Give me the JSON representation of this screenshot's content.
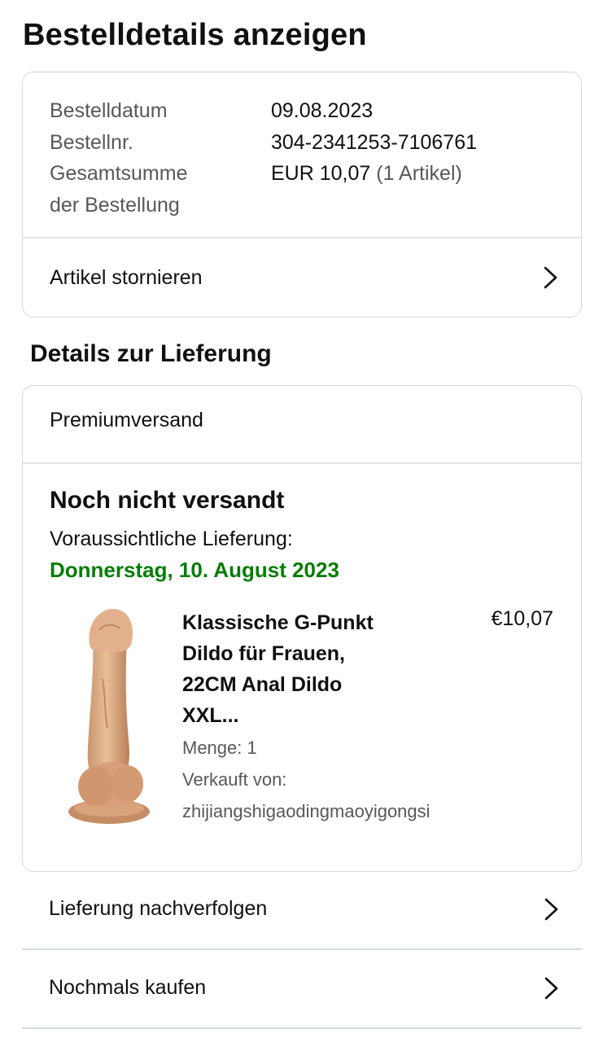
{
  "page": {
    "title": "Bestelldetails anzeigen"
  },
  "order_summary": {
    "rows": [
      {
        "label": "Bestelldatum",
        "value": "09.08.2023"
      },
      {
        "label": "Bestellnr.",
        "value": "304-2341253-7106761"
      },
      {
        "label_line1": "Gesamtsumme",
        "label_line2": "der Bestellung",
        "value": "EUR 10,07",
        "value_suffix": "(1 Artikel)"
      }
    ],
    "cancel_label": "Artikel stornieren"
  },
  "delivery": {
    "section_title": "Details zur Lieferung",
    "shipping_method": "Premiumversand",
    "status": "Noch nicht versandt",
    "eta_label": "Voraussichtliche Lieferung:",
    "eta_date": "Donnerstag, 10. August 2023",
    "eta_color": "#067d06",
    "item": {
      "title_lines": [
        "Klassische G-Punkt",
        "Dildo für Frauen,",
        "22CM Anal Dildo",
        "XXL..."
      ],
      "price": "€10,07",
      "quantity": "Menge: 1",
      "seller_label": "Verkauft von:",
      "seller_name": "zhijiangshigaodingmaoyigongsi",
      "image": "product-image"
    }
  },
  "actions": {
    "track_label": "Lieferung nachverfolgen",
    "buy_again_label": "Nochmals kaufen"
  },
  "colors": {
    "text": "#0f1111",
    "secondary_text": "#565959",
    "border": "#d5d9d9",
    "delivery_green": "#067d06"
  },
  "icons": {
    "chevron": "chevron-right-icon"
  }
}
